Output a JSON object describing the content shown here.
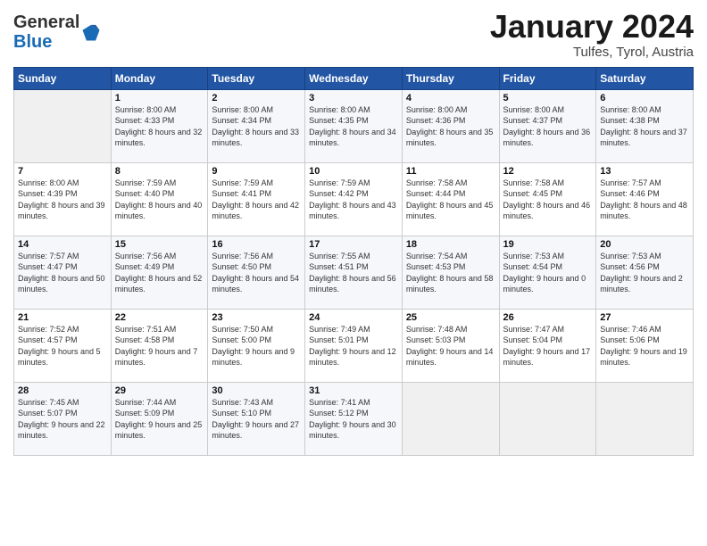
{
  "header": {
    "logo_general": "General",
    "logo_blue": "Blue",
    "month_title": "January 2024",
    "location": "Tulfes, Tyrol, Austria"
  },
  "weekdays": [
    "Sunday",
    "Monday",
    "Tuesday",
    "Wednesday",
    "Thursday",
    "Friday",
    "Saturday"
  ],
  "weeks": [
    [
      {
        "day": "",
        "sunrise": "",
        "sunset": "",
        "daylight": ""
      },
      {
        "day": "1",
        "sunrise": "8:00 AM",
        "sunset": "4:33 PM",
        "daylight": "8 hours and 32 minutes."
      },
      {
        "day": "2",
        "sunrise": "8:00 AM",
        "sunset": "4:34 PM",
        "daylight": "8 hours and 33 minutes."
      },
      {
        "day": "3",
        "sunrise": "8:00 AM",
        "sunset": "4:35 PM",
        "daylight": "8 hours and 34 minutes."
      },
      {
        "day": "4",
        "sunrise": "8:00 AM",
        "sunset": "4:36 PM",
        "daylight": "8 hours and 35 minutes."
      },
      {
        "day": "5",
        "sunrise": "8:00 AM",
        "sunset": "4:37 PM",
        "daylight": "8 hours and 36 minutes."
      },
      {
        "day": "6",
        "sunrise": "8:00 AM",
        "sunset": "4:38 PM",
        "daylight": "8 hours and 37 minutes."
      }
    ],
    [
      {
        "day": "7",
        "sunrise": "8:00 AM",
        "sunset": "4:39 PM",
        "daylight": "8 hours and 39 minutes."
      },
      {
        "day": "8",
        "sunrise": "7:59 AM",
        "sunset": "4:40 PM",
        "daylight": "8 hours and 40 minutes."
      },
      {
        "day": "9",
        "sunrise": "7:59 AM",
        "sunset": "4:41 PM",
        "daylight": "8 hours and 42 minutes."
      },
      {
        "day": "10",
        "sunrise": "7:59 AM",
        "sunset": "4:42 PM",
        "daylight": "8 hours and 43 minutes."
      },
      {
        "day": "11",
        "sunrise": "7:58 AM",
        "sunset": "4:44 PM",
        "daylight": "8 hours and 45 minutes."
      },
      {
        "day": "12",
        "sunrise": "7:58 AM",
        "sunset": "4:45 PM",
        "daylight": "8 hours and 46 minutes."
      },
      {
        "day": "13",
        "sunrise": "7:57 AM",
        "sunset": "4:46 PM",
        "daylight": "8 hours and 48 minutes."
      }
    ],
    [
      {
        "day": "14",
        "sunrise": "7:57 AM",
        "sunset": "4:47 PM",
        "daylight": "8 hours and 50 minutes."
      },
      {
        "day": "15",
        "sunrise": "7:56 AM",
        "sunset": "4:49 PM",
        "daylight": "8 hours and 52 minutes."
      },
      {
        "day": "16",
        "sunrise": "7:56 AM",
        "sunset": "4:50 PM",
        "daylight": "8 hours and 54 minutes."
      },
      {
        "day": "17",
        "sunrise": "7:55 AM",
        "sunset": "4:51 PM",
        "daylight": "8 hours and 56 minutes."
      },
      {
        "day": "18",
        "sunrise": "7:54 AM",
        "sunset": "4:53 PM",
        "daylight": "8 hours and 58 minutes."
      },
      {
        "day": "19",
        "sunrise": "7:53 AM",
        "sunset": "4:54 PM",
        "daylight": "9 hours and 0 minutes."
      },
      {
        "day": "20",
        "sunrise": "7:53 AM",
        "sunset": "4:56 PM",
        "daylight": "9 hours and 2 minutes."
      }
    ],
    [
      {
        "day": "21",
        "sunrise": "7:52 AM",
        "sunset": "4:57 PM",
        "daylight": "9 hours and 5 minutes."
      },
      {
        "day": "22",
        "sunrise": "7:51 AM",
        "sunset": "4:58 PM",
        "daylight": "9 hours and 7 minutes."
      },
      {
        "day": "23",
        "sunrise": "7:50 AM",
        "sunset": "5:00 PM",
        "daylight": "9 hours and 9 minutes."
      },
      {
        "day": "24",
        "sunrise": "7:49 AM",
        "sunset": "5:01 PM",
        "daylight": "9 hours and 12 minutes."
      },
      {
        "day": "25",
        "sunrise": "7:48 AM",
        "sunset": "5:03 PM",
        "daylight": "9 hours and 14 minutes."
      },
      {
        "day": "26",
        "sunrise": "7:47 AM",
        "sunset": "5:04 PM",
        "daylight": "9 hours and 17 minutes."
      },
      {
        "day": "27",
        "sunrise": "7:46 AM",
        "sunset": "5:06 PM",
        "daylight": "9 hours and 19 minutes."
      }
    ],
    [
      {
        "day": "28",
        "sunrise": "7:45 AM",
        "sunset": "5:07 PM",
        "daylight": "9 hours and 22 minutes."
      },
      {
        "day": "29",
        "sunrise": "7:44 AM",
        "sunset": "5:09 PM",
        "daylight": "9 hours and 25 minutes."
      },
      {
        "day": "30",
        "sunrise": "7:43 AM",
        "sunset": "5:10 PM",
        "daylight": "9 hours and 27 minutes."
      },
      {
        "day": "31",
        "sunrise": "7:41 AM",
        "sunset": "5:12 PM",
        "daylight": "9 hours and 30 minutes."
      },
      {
        "day": "",
        "sunrise": "",
        "sunset": "",
        "daylight": ""
      },
      {
        "day": "",
        "sunrise": "",
        "sunset": "",
        "daylight": ""
      },
      {
        "day": "",
        "sunrise": "",
        "sunset": "",
        "daylight": ""
      }
    ]
  ]
}
